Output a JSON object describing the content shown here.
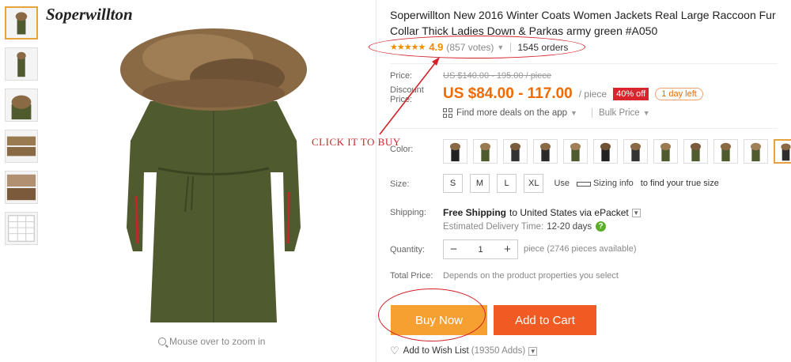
{
  "brand": "Soperwillton",
  "product": {
    "title": "Soperwillton New 2016 Winter Coats Women Jackets Real Large Raccoon Fur Collar Thick Ladies Down & Parkas army green #A050"
  },
  "rating": {
    "stars": "★★★★★",
    "score": "4.9",
    "votes": "(857 votes)",
    "orders": "1545 orders"
  },
  "labels": {
    "price": "Price:",
    "discount_price": "Discount Price:",
    "color": "Color:",
    "size": "Size:",
    "shipping": "Shipping:",
    "quantity": "Quantity:",
    "total_price": "Total Price:"
  },
  "price": {
    "original": "US $140.00 - 195.00 / piece",
    "discount": "US $84.00 - 117.00",
    "unit": "/ piece",
    "off_badge": "40% off",
    "time_left": "1 day left"
  },
  "app_deals": "Find more deals on the app",
  "bulk_price": "Bulk Price",
  "color_swatch_count": 12,
  "sizes": [
    "S",
    "M",
    "L",
    "XL"
  ],
  "size_help": {
    "use": "Use",
    "sizing_info": "Sizing info",
    "suffix": "to find your true size"
  },
  "shipping": {
    "free": "Free Shipping",
    "rest": "to United States via ePacket",
    "estimated_label": "Estimated Delivery Time:",
    "estimated_days": "12-20 days"
  },
  "quantity": {
    "value": "1",
    "available": "piece (2746 pieces available)"
  },
  "total_note": "Depends on the product properties you select",
  "buttons": {
    "buy_now": "Buy Now",
    "add_to_cart": "Add to Cart"
  },
  "wishlist": {
    "label": "Add to Wish List",
    "adds": "(19350 Adds)"
  },
  "zoom_hint": "Mouse over to zoom in",
  "annotation": "CLICK IT TO BUY",
  "colors": {
    "accent_orange": "#f06a00",
    "buy_now": "#f7a032",
    "add_to_cart": "#f15a22",
    "annotation_red": "#d2232a",
    "coat_green": "#4f5a2f"
  }
}
